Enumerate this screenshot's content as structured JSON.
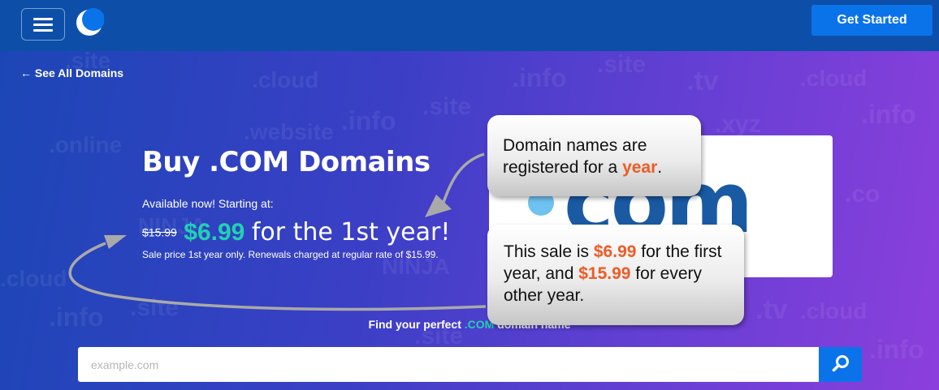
{
  "header": {
    "menu_icon": "hamburger-icon",
    "logo_icon": "crescent-moon-logo",
    "cta_label": "Get Started"
  },
  "background_words": [
    ".site",
    ".cloud",
    ".info",
    ".tv",
    ".online",
    ".website",
    ".xyz",
    ".co",
    "NINJA"
  ],
  "hero": {
    "back_link": "See All Domains",
    "back_icon": "arrow-left-icon",
    "title": "Buy .COM Domains",
    "available_text": "Available now! Starting at:",
    "old_price": "$15.99",
    "new_price": "$6.99",
    "price_suffix": "for the 1st year!",
    "sale_note": "Sale price 1st year only. Renewals charged at regular rate of $15.99.",
    "logo_text": "com"
  },
  "search": {
    "label_before": "Find your perfect ",
    "label_accent": ".COM",
    "label_after": " domain name",
    "placeholder": "example.com",
    "button_icon": "search-icon"
  },
  "callouts": {
    "first": {
      "text_before": "Domain names are registered for a ",
      "highlight": "year",
      "text_after": "."
    },
    "second": {
      "part1": "This sale is ",
      "price_sale": "$6.99",
      "part2": " for the first year, and ",
      "price_regular": "$15.99",
      "part3": " for every other year."
    }
  },
  "colors": {
    "header": "#0d4fa8",
    "button_blue": "#0b73ea",
    "accent_teal": "#21d1b3",
    "highlight_orange": "#ef5a24",
    "com_blue": "#1a5aa3"
  }
}
